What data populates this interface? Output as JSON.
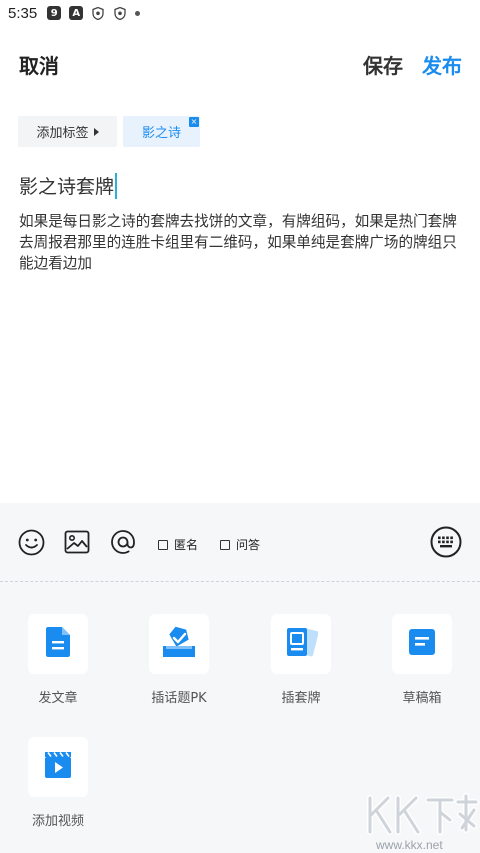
{
  "status_bar": {
    "time": "5:35",
    "icons": [
      "app-badge-icon",
      "a-letter-icon",
      "shield-icon",
      "shield-icon",
      "dot-icon"
    ],
    "badge_text": "9",
    "a_text": "A"
  },
  "header": {
    "cancel_label": "取消",
    "save_label": "保存",
    "publish_label": "发布",
    "accent_color": "#1a8cf0"
  },
  "tags": {
    "add_label": "添加标签",
    "selected": [
      {
        "label": "影之诗",
        "close": "×"
      }
    ]
  },
  "post": {
    "title": "影之诗套牌",
    "body": "如果是每日影之诗的套牌去找饼的文章，有牌组码，如果是热门套牌去周报君那里的连胜卡组里有二维码，如果单纯是套牌广场的牌组只能边看边加"
  },
  "toolbar": {
    "icons": [
      "emoji-icon",
      "image-icon",
      "at-icon",
      "keyboard-icon"
    ],
    "anonymous_label": "匿名",
    "qa_label": "问答"
  },
  "actions": [
    {
      "label": "发文章",
      "icon": "article-icon"
    },
    {
      "label": "插话题PK",
      "icon": "topic-pk-icon"
    },
    {
      "label": "插套牌",
      "icon": "deck-icon"
    },
    {
      "label": "草稿箱",
      "icon": "drafts-icon"
    },
    {
      "label": "添加视频",
      "icon": "video-icon"
    }
  ],
  "watermark": {
    "brand": "KK下载",
    "url": "www.kkx.net"
  }
}
